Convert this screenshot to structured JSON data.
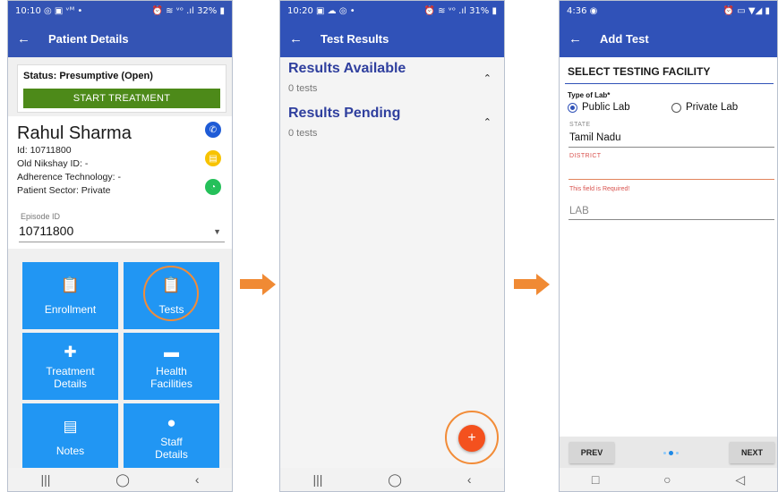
{
  "screen1": {
    "status": {
      "time": "10:10",
      "icons_left": "◎ ▣ ᵛᴹ •",
      "icons_right": "⏰ ≋ ᵛᵒ .ıl 32% ▮"
    },
    "title": "Patient Details",
    "status_label": "Status: Presumptive (Open)",
    "start_button": "START TREATMENT",
    "patient": {
      "name": "Rahul Sharma",
      "id": "Id: 10711800",
      "old_id": "Old Nikshay ID: -",
      "adherence": "Adherence Technology: -",
      "sector": "Patient Sector: Private"
    },
    "episode": {
      "label": "Episode ID",
      "value": "10711800"
    },
    "tiles": [
      {
        "label": "Enrollment",
        "icon": "clipboard-icon"
      },
      {
        "label": "Tests",
        "icon": "clipboard-outline-icon"
      },
      {
        "label": "Treatment\nDetails",
        "icon": "medical-cross-icon"
      },
      {
        "label": "Health\nFacilities",
        "icon": "store-icon"
      },
      {
        "label": "Notes",
        "icon": "notes-icon"
      },
      {
        "label": "Staff\nDetails",
        "icon": "person-icon"
      }
    ],
    "colors": {
      "appbar": "#3454b4",
      "tile": "#2196f3",
      "start": "#4d8a19"
    }
  },
  "screen2": {
    "status": {
      "time": "10:20",
      "icons_left": "▣ ☁ ◎ •",
      "icons_right": "⏰ ≋ ᵛᵒ .ıl 31% ▮"
    },
    "title": "Test Results",
    "sections": [
      {
        "title": "Results Available",
        "count": "0 tests"
      },
      {
        "title": "Results Pending",
        "count": "0 tests"
      }
    ],
    "fab": "+"
  },
  "screen3": {
    "status": {
      "time": "4:36",
      "icons_left": "◉",
      "icons_right": "⏰ ▭ ▼◢ ▮"
    },
    "title": "Add Test",
    "section": "SELECT TESTING FACILITY",
    "lab_type_label": "Type of Lab*",
    "lab_options": [
      "Public Lab",
      "Private Lab"
    ],
    "state_caption": "STATE",
    "state_value": "Tamil Nadu",
    "district_caption": "DISTRICT",
    "district_error": "This field is Required!",
    "lab_placeholder": "LAB",
    "prev": "PREV",
    "next": "NEXT"
  },
  "nav": {
    "recent": "|||",
    "home": "◯",
    "back": "‹"
  },
  "nav3": {
    "recent": "□",
    "home": "○",
    "back": "◁"
  },
  "highlight_color": "#f28c38"
}
